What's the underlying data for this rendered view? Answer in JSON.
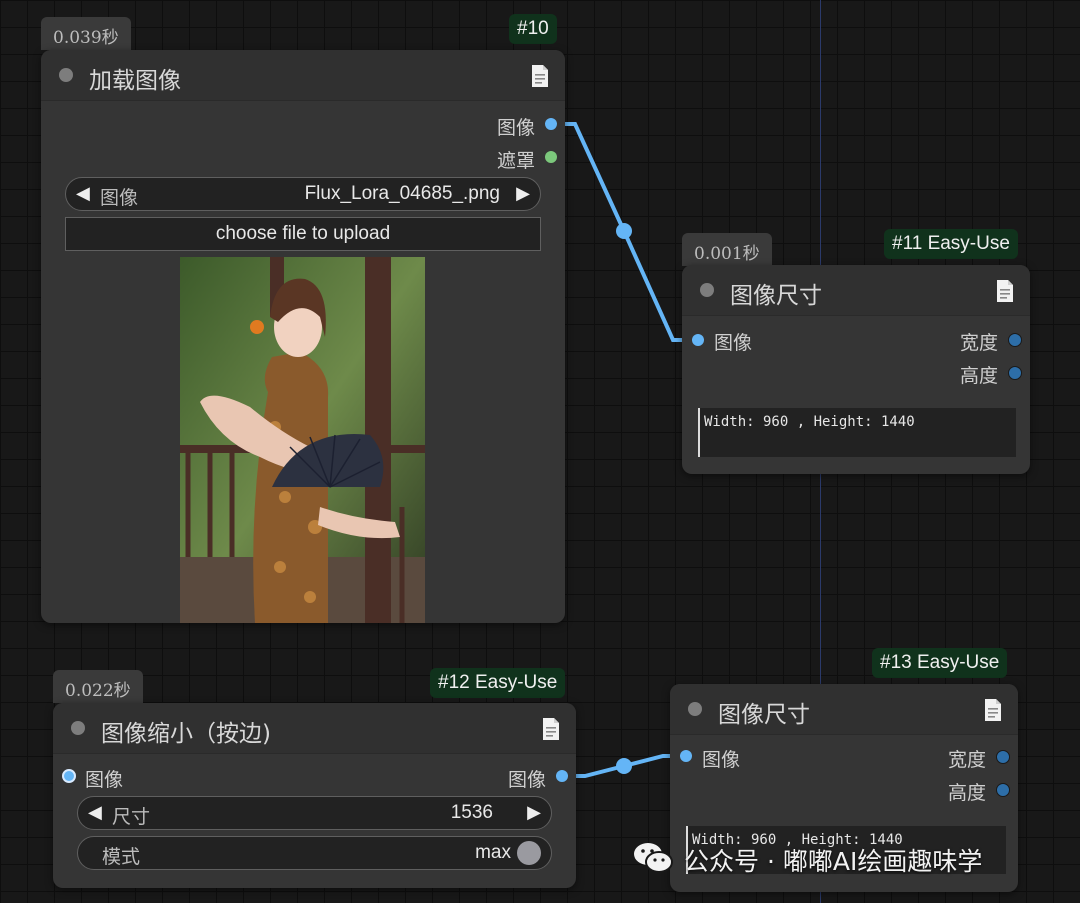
{
  "node10": {
    "time": "0.039秒",
    "id": "#10",
    "title": "加载图像",
    "outputs": [
      "图像",
      "遮罩"
    ],
    "image_widget_label": "图像",
    "image_widget_value": "Flux_Lora_04685_.png",
    "upload_label": "choose file to upload"
  },
  "node11": {
    "time": "0.001秒",
    "id": "#11 Easy-Use",
    "title": "图像尺寸",
    "input": "图像",
    "outputs": [
      "宽度",
      "高度"
    ],
    "text": "Width: 960 , Height: 1440"
  },
  "node12": {
    "time": "0.022秒",
    "id": "#12 Easy-Use",
    "title": "图像缩小（按边)",
    "input": "图像",
    "output": "图像",
    "size_label": "尺寸",
    "size_value": "1536",
    "mode_label": "模式",
    "mode_value": "max"
  },
  "node13": {
    "id": "#13 Easy-Use",
    "title": "图像尺寸",
    "input": "图像",
    "outputs": [
      "宽度",
      "高度"
    ],
    "text": "Width: 960 , Height: 1440"
  },
  "watermark": "公众号 · 嘟嘟AI绘画趣味学",
  "colors": {
    "link": "#64b5f6",
    "id_badge_bg": "#10321c",
    "node_bg": "#353535"
  }
}
